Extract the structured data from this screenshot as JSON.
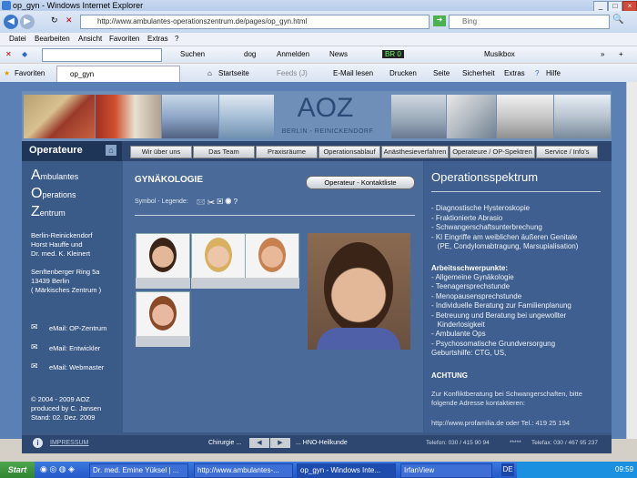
{
  "window": {
    "title": "op_gyn - Windows Internet Explorer"
  },
  "address": {
    "url": "http://www.ambulantes-operationszentrum.de/pages/op_gyn.html",
    "search_placeholder": "Bing"
  },
  "menu": {
    "items": [
      "Datei",
      "Bearbeiten",
      "Ansicht",
      "Favoriten",
      "Extras",
      "?"
    ]
  },
  "toolbar": {
    "search_label": "Suchen",
    "dog_label": "dog",
    "login_label": "Anmelden",
    "news_label": "News",
    "musicbox_label": "Musikbox",
    "radio_label": "BR 0"
  },
  "favbar": {
    "favorites_label": "Favoriten",
    "tab_label": "op_gyn",
    "home_label": "Startseite",
    "feeds_label": "Feeds (J)",
    "mail_label": "E-Mail lesen",
    "print_label": "Drucken",
    "page_label": "Seite",
    "security_label": "Sicherheit",
    "extras_label": "Extras",
    "help_label": "Hilfe"
  },
  "site": {
    "logo": "AOZ",
    "logo_sub": "BERLIN - REINICKENDORF",
    "section_title": "Operateure",
    "nav": [
      "Wir über uns",
      "Das Team",
      "Praxisräume",
      "Operationsablauf",
      "Anästhesieverfahren",
      "Operateure / OP-Spektren",
      "Service / Info's"
    ],
    "left": {
      "a_letter": "A",
      "a_rest": "mbulantes",
      "o_letter": "O",
      "o_rest": "perations",
      "z_letter": "Z",
      "z_rest": "entrum",
      "address_lines": [
        "Berlin-Reinickendorf",
        "Horst Hauffe und",
        "Dr. med. K. Kleinert",
        "",
        "Senftenberger Ring 5a",
        "13439 Berlin",
        "( Märkisches Zentrum )"
      ],
      "email_links": [
        "eMail: OP-Zentrum",
        "eMail: Entwickler",
        "eMail: Webmaster"
      ],
      "copyright_lines": [
        "© 2004 - 2009 AOZ",
        "produced by  C. Jansen",
        "Stand: 02. Dez. 2009"
      ]
    },
    "main": {
      "heading": "GYNÄKOLOGIE",
      "contact_button": "Operateur - Kontaktliste",
      "legend_label": "Symbol - Legende:"
    },
    "right": {
      "heading": "Operationsspektrum",
      "list1": [
        "- Diagnostische Hysteroskopie",
        "- Fraktionierte Abrasio",
        "- Schwangerschaftsunterbrechung",
        "- Kl Eingriffe am weiblichen äußeren Genitale",
        "   (PE, Condylomabtragung, Marsupialisation)"
      ],
      "focus_heading": "Arbeitsschwerpunkte:",
      "list2": [
        "- Allgemeine Gynäkologie",
        "- Teenagersprechstunde",
        "- Menopausensprechstunde",
        "- Individuelle Beratung zur Familienplanung",
        "- Betreuung und Beratung bei ungewollter",
        "   Kinderlosigkeit",
        "- Ambulante Ops",
        "- Psychosomatische Grundversorgung",
        "Geburtshilfe: CTG, US,"
      ],
      "attention": "ACHTUNG",
      "note_lines": [
        "Zur Konfliktberatung bei Schwangerschaften, bitte",
        "folgende Adresse kontaktieren:"
      ],
      "link_line": "http://www.profamilia.de oder Tel.: 419 25 194"
    },
    "footer": {
      "impressum": "IMPRESSUM",
      "prev": "Chirurgie ...",
      "next": "... HNO-Heilkunde",
      "phone": "Telefon: 030 / 415 90 94",
      "stars": "*****",
      "fax": "Telefax:  030 / 467 95 237"
    }
  },
  "taskbar": {
    "start": "Start",
    "tasks": [
      "Dr. med. Emine Yüksel | ...",
      "http://www.ambulantes-...",
      "op_gyn - Windows Inte...",
      "IrfanView"
    ],
    "lang": "DE",
    "clock": "09:59"
  }
}
